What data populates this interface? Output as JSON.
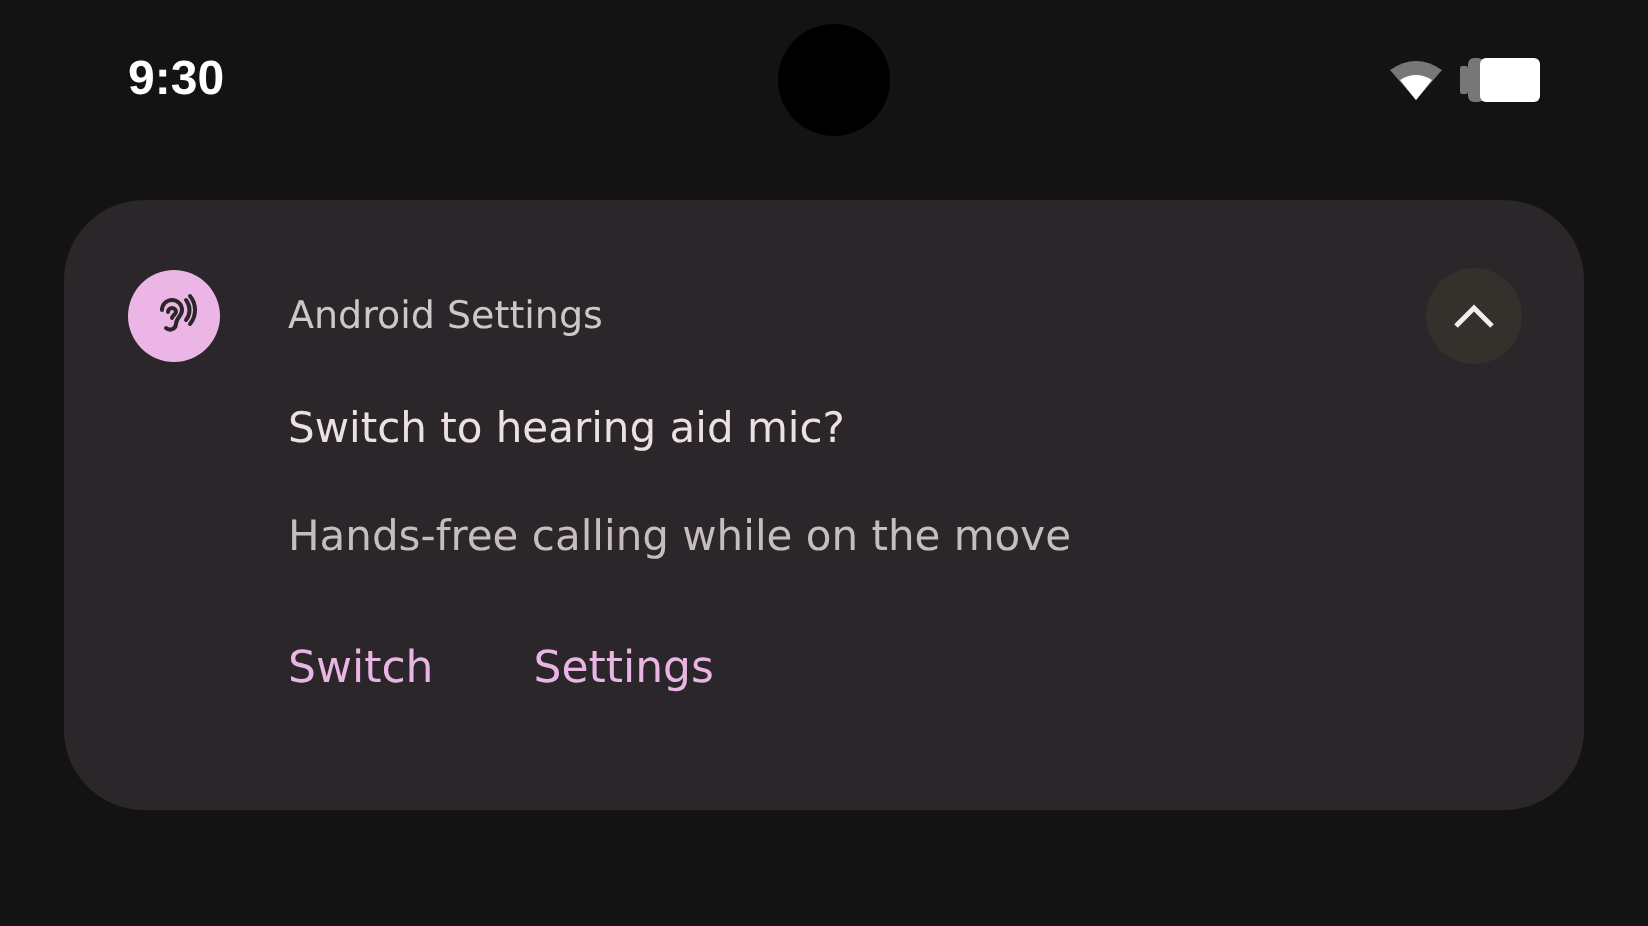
{
  "status_bar": {
    "time": "9:30"
  },
  "notification": {
    "app_name": "Android Settings",
    "expanded": true,
    "title": "Switch to hearing aid mic?",
    "text": "Hands-free calling while on the move",
    "actions": [
      "Switch",
      "Settings"
    ]
  }
}
